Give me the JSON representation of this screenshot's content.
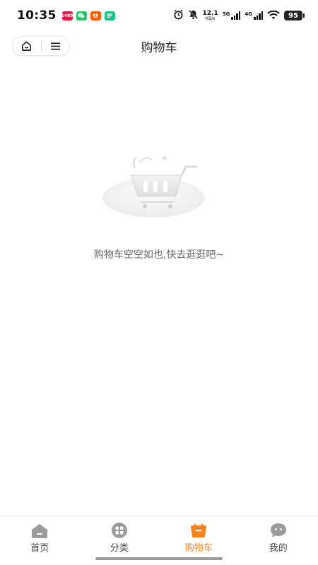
{
  "status_bar": {
    "time": "10:35",
    "notifications": [
      {
        "name": "app-notification-icon",
        "color": "#e8174a",
        "glyph": "1489"
      },
      {
        "name": "wechat-icon",
        "color": "#2dc26b",
        "glyph": ""
      },
      {
        "name": "taobao-icon",
        "color": "#ff5a00",
        "glyph": ""
      },
      {
        "name": "message-app-icon",
        "color": "#19c48a",
        "glyph": ""
      }
    ],
    "net_speed": "12.1",
    "net_speed_unit": "KB/s",
    "signal1_label": "5G",
    "signal2_label": "4G",
    "battery": "95"
  },
  "header": {
    "title": "购物车",
    "home_icon": "home-icon",
    "menu_icon": "menu-icon"
  },
  "empty_state": {
    "text": "购物车空空如也,快去逛逛吧~",
    "illustration": "empty-cart-icon"
  },
  "tabbar": {
    "accent": "#f5821f",
    "inactive_color": "#9b9b9b",
    "tabs": [
      {
        "label": "首页",
        "icon": "home-tab-icon",
        "active": false
      },
      {
        "label": "分类",
        "icon": "category-icon",
        "active": false
      },
      {
        "label": "购物车",
        "icon": "cart-icon",
        "active": true
      },
      {
        "label": "我的",
        "icon": "profile-icon",
        "active": false
      }
    ]
  }
}
